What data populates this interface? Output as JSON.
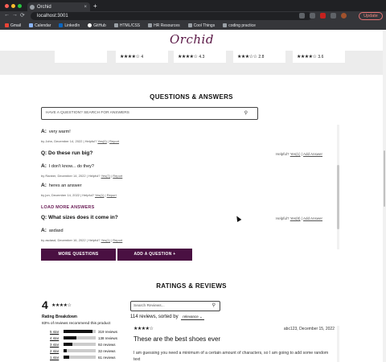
{
  "browser": {
    "tab_title": "Orchid",
    "tab_close": "×",
    "new_tab": "+",
    "url": "localhost:3001",
    "update_label": "Update",
    "nav": {
      "back": "←",
      "forward": "→",
      "reload": "⟳"
    },
    "bookmarks": [
      "Gmail",
      "Calendar",
      "LinkedIn",
      "GitHub",
      "HTML/CSS",
      "HR Resources",
      "Cool Things",
      "coding practice"
    ]
  },
  "site": {
    "logo": "Orchid"
  },
  "carousel": {
    "cards": [
      {
        "stars": "",
        "rating": ""
      },
      {
        "stars": "★★★★☆",
        "rating": "4"
      },
      {
        "stars": "★★★★☆",
        "rating": "4.3"
      },
      {
        "stars": "★★★☆☆",
        "rating": "2.8"
      },
      {
        "stars": "★★★★☆",
        "rating": "3.6"
      }
    ]
  },
  "qa": {
    "title": "QUESTIONS & ANSWERS",
    "search_placeholder": "HAVE A QUESTION? SEARCH FOR ANSWERS",
    "search_icon": "⚲",
    "answer_prefix": "A:",
    "question_prefix": "Q:",
    "items": {
      "a1_text": "very warm!",
      "a1_meta_prefix": "by John, December 14, 2022  |  Helpful?",
      "a1_yes": "Yes(0)",
      "a1_report": "Report",
      "q1_text": "Do these run big?",
      "q1_helpful": "Helpful?",
      "q1_yes": "Yes(1)",
      "q1_add": "Add Answer",
      "a2_text": "I don't know... do they?",
      "a2_meta_prefix": "by Ranber, December 14, 2022  |  Helpful?",
      "a2_yes": "Yes(7)",
      "a2_report": "Report",
      "a3_text": "heres an answer",
      "a3_meta_prefix": "by jon, December 14, 2022  |  Helpful?",
      "a3_yes": "Yes(1)",
      "a3_report": "Report",
      "load_more": "LOAD MORE ANSWERS",
      "q2_text": "What sizes does it come in?",
      "q2_helpful": "Helpful?",
      "q2_yes": "Yes(8)",
      "q2_add": "Add Answer",
      "a4_text": "asdasd",
      "a4_meta_prefix": "by asdasd, December 16, 2022  |  Helpful?",
      "a4_yes": "Yes(1)",
      "a4_report": "Report"
    },
    "more_questions": "MORE QUESTIONS",
    "add_question": "ADD A QUESTION +"
  },
  "reviews": {
    "title": "RATINGS & REVIEWS",
    "average": "4",
    "average_stars": "★★★★☆",
    "breakdown_title": "Rating Breakdown",
    "recommend": "83% of reviews recommend this product",
    "breakdown": [
      {
        "label": "5 star",
        "count": "319 reviews",
        "fraction": 0.9
      },
      {
        "label": "4 star",
        "count": "138 reviews",
        "fraction": 0.4
      },
      {
        "label": "3 star",
        "count": "92 reviews",
        "fraction": 0.27
      },
      {
        "label": "2 star",
        "count": "32 reviews",
        "fraction": 0.1
      },
      {
        "label": "1 star",
        "count": "61 reviews",
        "fraction": 0.18
      }
    ],
    "search_placeholder": "Search Reviews...",
    "search_icon": "⚲",
    "sort_prefix": "114 reviews, sorted by",
    "sort_value": "relevance",
    "sort_chevron": "⌄",
    "review": {
      "stars": "★★★★☆",
      "user": "abc123, December 15, 2022",
      "title": "These are the best shoes ever",
      "body": "I am guessing you need a minimum of a certain amount of characters, so I am going to add some random text"
    }
  },
  "colors": {
    "brand": "#5a1846",
    "button": "#4a1042",
    "link": "#6b1e57"
  }
}
